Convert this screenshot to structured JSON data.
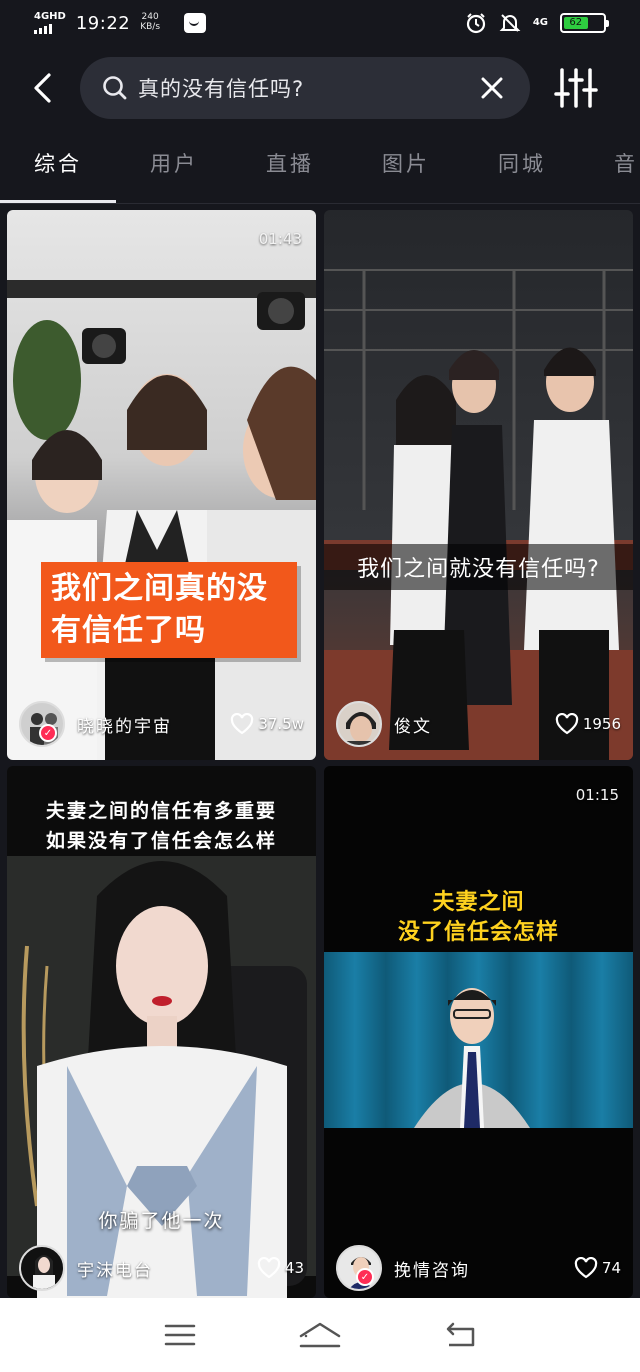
{
  "status_bar": {
    "network": "4GHD",
    "time": "19:22",
    "speed_value": "240",
    "speed_unit": "KB/s",
    "signal_right": "4G",
    "battery": "62",
    "battery_level_percent": 62,
    "icons": [
      "signal-icon",
      "message-icon",
      "alarm-icon",
      "mute-icon",
      "battery-icon"
    ]
  },
  "search": {
    "query": "真的没有信任吗?"
  },
  "tabs": [
    {
      "label": "综合",
      "active": true
    },
    {
      "label": "用户",
      "active": false
    },
    {
      "label": "直播",
      "active": false
    },
    {
      "label": "图片",
      "active": false
    },
    {
      "label": "同城",
      "active": false
    },
    {
      "label": "音",
      "active": false
    }
  ],
  "videos": [
    {
      "duration": "01:43",
      "caption": "我们之间真的没有信任了吗",
      "author": "晓晓的宇宙",
      "likes": "37.5w",
      "verified": true
    },
    {
      "duration": "",
      "caption": "我们之间就没有信任吗?",
      "author": "俊文",
      "likes": "1956",
      "verified": false
    },
    {
      "duration": "",
      "caption_line1": "夫妻之间的信任有多重要",
      "caption_line2": "如果没有了信任会怎么样",
      "subtitle": "你骗了他一次",
      "author": "宇沫电台",
      "likes": "43",
      "verified": false
    },
    {
      "duration": "01:15",
      "caption_line1": "夫妻之间",
      "caption_line2": "没了信任会怎样",
      "author": "挽情咨询",
      "likes": "74",
      "verified": true
    }
  ],
  "colors": {
    "background": "#16171d",
    "search_bg": "#2c2e37",
    "accent_orange": "#f2581b",
    "caption_yellow": "#ffd21f",
    "verified_red": "#ff2d55"
  }
}
